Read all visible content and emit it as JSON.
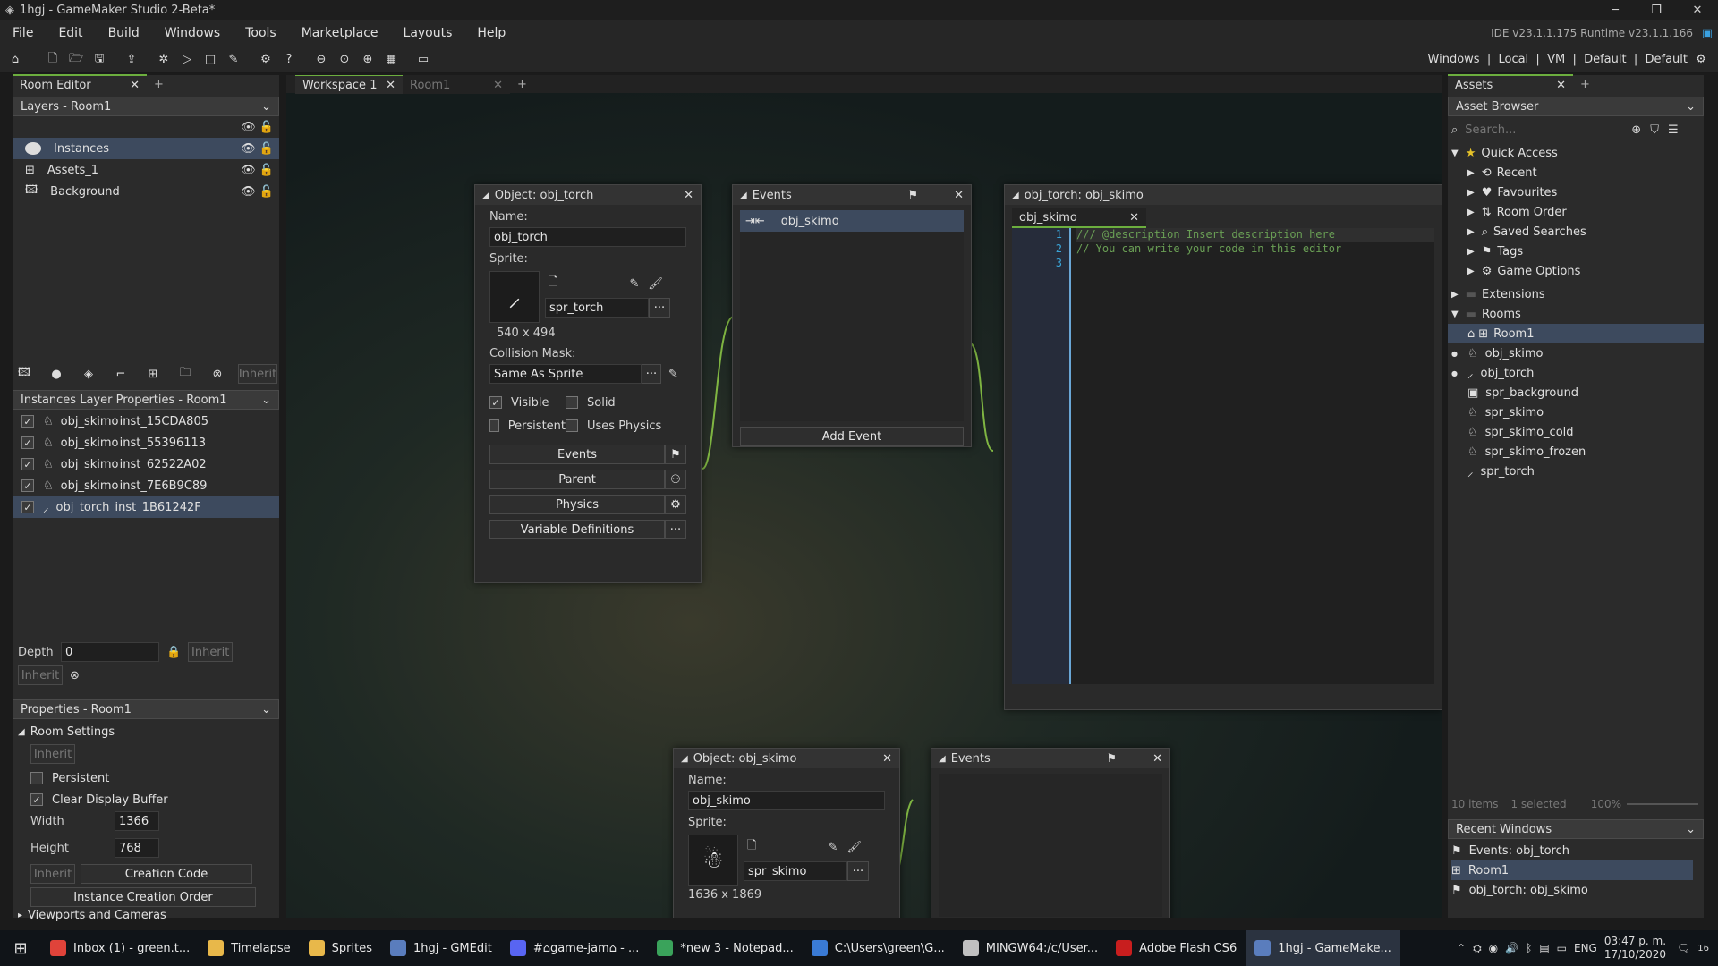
{
  "window": {
    "title": "1hgj - GameMaker Studio 2-Beta*",
    "version": "IDE v23.1.1.175  Runtime v23.1.1.166"
  },
  "menu": [
    "File",
    "Edit",
    "Build",
    "Windows",
    "Tools",
    "Marketplace",
    "Layouts",
    "Help"
  ],
  "targets": "Windows  |  Local  |  VM  |  Default  |  Default",
  "left": {
    "tab": "Room Editor",
    "layers_header": "Layers - Room1",
    "layers": [
      "Instances",
      "Assets_1",
      "Background"
    ],
    "inherit_btn": "Inherit",
    "inst_header": "Instances Layer Properties - Room1",
    "instances": [
      {
        "obj": "obj_skimo",
        "id": "inst_15CDA805"
      },
      {
        "obj": "obj_skimo",
        "id": "inst_55396113"
      },
      {
        "obj": "obj_skimo",
        "id": "inst_62522A02"
      },
      {
        "obj": "obj_skimo",
        "id": "inst_7E6B9C89"
      },
      {
        "obj": "obj_torch",
        "id": "inst_1B61242F"
      }
    ],
    "depth_label": "Depth",
    "depth_value": "0",
    "inherit": "Inherit",
    "props_header": "Properties - Room1",
    "room_settings": "Room Settings",
    "persistent": "Persistent",
    "clear_display": "Clear Display Buffer",
    "width_label": "Width",
    "width_value": "1366",
    "height_label": "Height",
    "height_value": "768",
    "creation_code": "Creation Code",
    "instance_order": "Instance Creation Order",
    "viewports": "Viewports and Cameras"
  },
  "center": {
    "tabs": [
      "Workspace 1",
      "Room1"
    ],
    "obj_torch": {
      "title": "Object: obj_torch",
      "name_label": "Name:",
      "name": "obj_torch",
      "sprite_label": "Sprite:",
      "sprite": "spr_torch",
      "size": "540 x 494",
      "mask_label": "Collision Mask:",
      "mask": "Same As Sprite",
      "visible": "Visible",
      "solid": "Solid",
      "persistent": "Persistent",
      "physics_cb": "Uses Physics",
      "events": "Events",
      "parent": "Parent",
      "physics": "Physics",
      "vars": "Variable Definitions"
    },
    "events1": {
      "title": "Events",
      "item": "obj_skimo",
      "add": "Add Event"
    },
    "code": {
      "title": "obj_torch: obj_skimo",
      "tab": "obj_skimo",
      "lines": [
        "/// @description Insert description here",
        "// You can write your code in this editor",
        ""
      ]
    },
    "obj_skimo": {
      "title": "Object: obj_skimo",
      "name_label": "Name:",
      "name": "obj_skimo",
      "sprite_label": "Sprite:",
      "sprite": "spr_skimo",
      "size": "1636 x 1869"
    },
    "events2": {
      "title": "Events"
    }
  },
  "right": {
    "tab": "Assets",
    "browser": "Asset Browser",
    "search_ph": "Search...",
    "quick": "Quick Access",
    "quick_items": [
      "Recent",
      "Favourites",
      "Room Order",
      "Saved Searches",
      "Tags",
      "Game Options"
    ],
    "extensions": "Extensions",
    "rooms": "Rooms",
    "room1": "Room1",
    "assets": [
      "obj_skimo",
      "obj_torch",
      "spr_background",
      "spr_skimo",
      "spr_skimo_cold",
      "spr_skimo_frozen",
      "spr_torch"
    ],
    "status_items": "10 items",
    "status_sel": "1 selected",
    "zoom": "100%",
    "recent_header": "Recent Windows",
    "recent": [
      "Events: obj_torch",
      "Room1",
      "obj_torch: obj_skimo"
    ]
  },
  "taskbar": {
    "items": [
      "Inbox (1) - green.t...",
      "Timelapse",
      "Sprites",
      "1hgj - GMEdit",
      "#⌂game-jam⌂ - ...",
      "*new 3 - Notepad...",
      "C:\\Users\\green\\G...",
      "MINGW64:/c/User...",
      "Adobe Flash CS6",
      "1hgj - GameMake..."
    ],
    "lang": "ENG",
    "time": "03:47 p. m.",
    "date": "17/10/2020",
    "notif": "16"
  },
  "colors": {
    "accent": "#6cae3e",
    "selection": "#3d4a5e"
  }
}
